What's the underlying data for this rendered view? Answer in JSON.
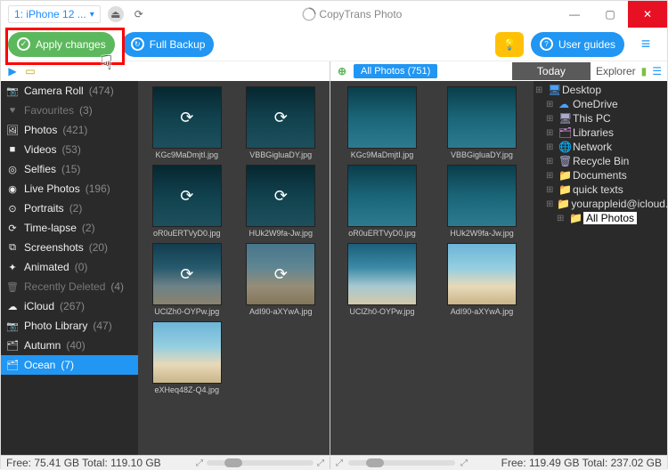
{
  "titlebar": {
    "device": "1: iPhone 12 ...",
    "app_name": "CopyTrans Photo"
  },
  "toolbar": {
    "apply_label": "Apply changes",
    "full_backup_label": "Full Backup",
    "user_guides_label": "User guides"
  },
  "sidebar": {
    "items": [
      {
        "icon": "📷",
        "label": "Camera Roll",
        "count": "(474)"
      },
      {
        "icon": "♥",
        "label": "Favourites",
        "count": "(3)",
        "muted": true
      },
      {
        "icon": "🖼",
        "label": "Photos",
        "count": "(421)"
      },
      {
        "icon": "■",
        "label": "Videos",
        "count": "(53)"
      },
      {
        "icon": "◎",
        "label": "Selfies",
        "count": "(15)"
      },
      {
        "icon": "◉",
        "label": "Live Photos",
        "count": "(196)"
      },
      {
        "icon": "⊙",
        "label": "Portraits",
        "count": "(2)"
      },
      {
        "icon": "⟳",
        "label": "Time-lapse",
        "count": "(2)"
      },
      {
        "icon": "⧉",
        "label": "Screenshots",
        "count": "(20)"
      },
      {
        "icon": "✦",
        "label": "Animated",
        "count": "(0)"
      },
      {
        "icon": "🗑",
        "label": "Recently Deleted",
        "count": "(4)",
        "muted": true
      },
      {
        "icon": "☁",
        "label": "iCloud",
        "count": "(267)"
      },
      {
        "icon": "📷",
        "label": "Photo Library",
        "count": "(47)"
      },
      {
        "icon": "🗂",
        "label": "Autumn",
        "count": "(40)"
      },
      {
        "icon": "🗂",
        "label": "Ocean",
        "count": "(7)",
        "selected": true
      }
    ]
  },
  "left_grid": {
    "thumbs": [
      {
        "file": "KGc9MaDmjtI.jpg",
        "style": "cliff",
        "sync": true
      },
      {
        "file": "VBBGigluaDY.jpg",
        "style": "cliff",
        "sync": true
      },
      {
        "file": "oR0uERTVyD0.jpg",
        "style": "cliff",
        "sync": true
      },
      {
        "file": "HUk2W9fa-Jw.jpg",
        "style": "cliff",
        "sync": true
      },
      {
        "file": "UClZh0-OYPw.jpg",
        "style": "ocean",
        "sync": true
      },
      {
        "file": "AdI90-aXYwA.jpg",
        "style": "beach",
        "sync": true
      },
      {
        "file": "eXHeq48Z-Q4.jpg",
        "style": "beach",
        "sync": false
      }
    ]
  },
  "right_header": {
    "all_photos": "All Photos (751)",
    "today": "Today",
    "explorer_label": "Explorer"
  },
  "right_grid": {
    "thumbs": [
      {
        "file": "KGc9MaDmjtI.jpg",
        "style": "cliff"
      },
      {
        "file": "VBBGigluaDY.jpg",
        "style": "cliff"
      },
      {
        "file": "oR0uERTVyD0.jpg",
        "style": "cliff"
      },
      {
        "file": "HUk2W9fa-Jw.jpg",
        "style": "cliff"
      },
      {
        "file": "UClZh0-OYPw.jpg",
        "style": "ocean"
      },
      {
        "file": "AdI90-aXYwA.jpg",
        "style": "beach"
      }
    ]
  },
  "explorer": {
    "items": [
      {
        "ind": 0,
        "icon": "🖥",
        "label": "Desktop",
        "color": "#4aa0ff"
      },
      {
        "ind": 1,
        "icon": "☁",
        "label": "OneDrive",
        "color": "#4aa0ff"
      },
      {
        "ind": 1,
        "icon": "🖥",
        "label": "This PC",
        "color": "#aac"
      },
      {
        "ind": 1,
        "icon": "🗂",
        "label": "Libraries",
        "color": "#c090d0"
      },
      {
        "ind": 1,
        "icon": "🌐",
        "label": "Network",
        "color": "#aac"
      },
      {
        "ind": 1,
        "icon": "🗑",
        "label": "Recycle Bin",
        "color": "#aac"
      },
      {
        "ind": 1,
        "icon": "📁",
        "label": "Documents",
        "color": "#f0c020"
      },
      {
        "ind": 1,
        "icon": "📁",
        "label": "quick texts",
        "color": "#f0c020"
      },
      {
        "ind": 1,
        "icon": "📁",
        "label": "yourappleid@icloud.com's",
        "color": "#f0c020"
      },
      {
        "ind": 2,
        "icon": "📁",
        "label": "All Photos",
        "highlight": true,
        "color": "#7ed0d0"
      }
    ]
  },
  "footer": {
    "left": "Free: 75.41 GB Total: 119.10 GB",
    "right": "Free: 119.49 GB Total: 237.02 GB"
  }
}
